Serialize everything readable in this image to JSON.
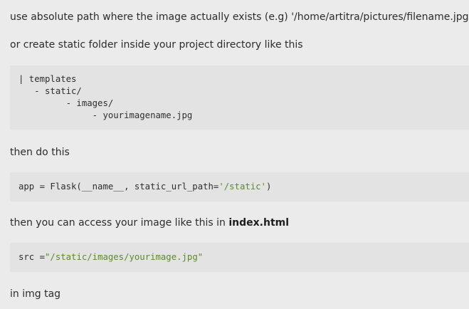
{
  "answer": {
    "p1": "use absolute path where the image actually exists (e.g) '/home/artitra/pictures/filename.jpg'",
    "p2": "or create static folder inside your project directory like this",
    "tree": [
      "| templates",
      "   - static/",
      "         - images/",
      "              - yourimagename.jpg"
    ],
    "p3": "then do this",
    "code_app": {
      "prefix": "app = Flask(__name__, static_url_path=",
      "string": "'/static'",
      "suffix": ")"
    },
    "p4_text": "then you can access your image like this in ",
    "p4_bold": "index.html",
    "code_src": {
      "prefix": "src =",
      "string": "\"/static/images/yourimage.jpg\""
    },
    "p5": "in img tag"
  },
  "colors": {
    "background": "#ebebeb",
    "code_background": "#e3e3e3",
    "string_literal": "#5d8a2a"
  }
}
